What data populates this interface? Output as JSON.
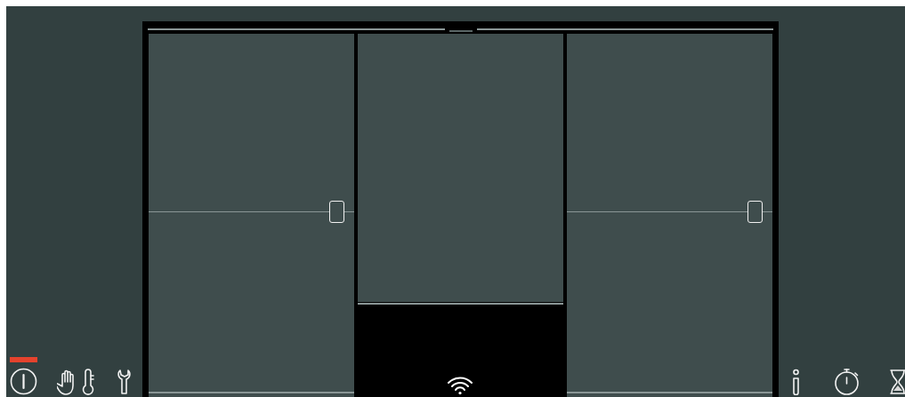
{
  "panels": [
    {
      "kind": "door"
    },
    {
      "kind": "fixed"
    },
    {
      "kind": "door"
    }
  ],
  "status": {
    "wifi_connected": true
  },
  "left_controls": [
    {
      "kind": "power",
      "selected": true
    },
    {
      "kind": "hand",
      "selected": false
    },
    {
      "kind": "thermometer",
      "selected": false
    },
    {
      "kind": "wrench",
      "selected": false
    }
  ],
  "right_controls": [
    {
      "kind": "info",
      "selected": false
    },
    {
      "kind": "stopwatch",
      "selected": false
    },
    {
      "kind": "hourglass",
      "selected": false
    }
  ]
}
